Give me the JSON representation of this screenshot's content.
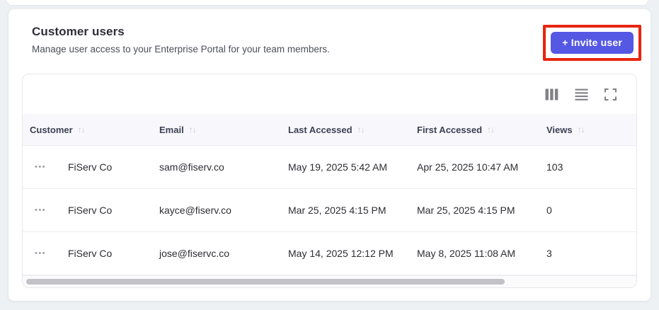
{
  "header": {
    "title": "Customer users",
    "subtitle": "Manage user access to your Enterprise Portal for your team members.",
    "invite_button_label": "+ Invite user"
  },
  "annotation": {
    "type": "highlight-box",
    "color": "#e8250c",
    "target": "invite-button"
  },
  "toolbar": {
    "icons": [
      {
        "name": "columns-icon"
      },
      {
        "name": "row-density-icon"
      },
      {
        "name": "fullscreen-icon"
      }
    ]
  },
  "table": {
    "sort_glyph": "↑↓",
    "row_actions_glyph": "•••",
    "columns": [
      {
        "label": "Customer"
      },
      {
        "label": "Email"
      },
      {
        "label": "Last Accessed"
      },
      {
        "label": "First Accessed"
      },
      {
        "label": "Views"
      }
    ],
    "rows": [
      {
        "customer": "FiServ Co",
        "email": "sam@fiserv.co",
        "last_accessed": "May 19, 2025 5:42 AM",
        "first_accessed": "Apr 25, 2025 10:47 AM",
        "views": "103"
      },
      {
        "customer": "FiServ Co",
        "email": "kayce@fiserv.co",
        "last_accessed": "Mar 25, 2025 4:15 PM",
        "first_accessed": "Mar 25, 2025 4:15 PM",
        "views": "0"
      },
      {
        "customer": "FiServ Co",
        "email": "jose@fiservc.co",
        "last_accessed": "May 14, 2025 12:12 PM",
        "first_accessed": "May 8, 2025 11:08 AM",
        "views": "3"
      }
    ]
  },
  "colors": {
    "page_background": "#edf1f4",
    "card_background": "#ffffff",
    "accent_button": "#5558e3",
    "annotation_red": "#e8250c",
    "table_header_background": "#f8f8fc",
    "header_text": "#3c3f52",
    "body_text": "#2d2d33",
    "icon_gray": "#808086",
    "scrollbar_thumb": "#c2c2c8"
  }
}
